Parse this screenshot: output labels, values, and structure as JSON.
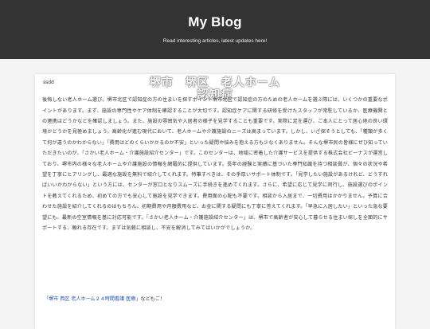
{
  "header": {
    "title": "My Blog",
    "tagline": "Read interesting articles, latest updates here!"
  },
  "post": {
    "heading_line1": "堺市　堺区　老人ホーム",
    "heading_line2": "認知症",
    "author": "ssdd",
    "body": "後悔しない老人ホーム選び。堺市北区で認知症の方の住まいを探すポイント堺市北区で認知症の方のための老人ホームを選ぶ際には、いくつかの重要なポイントがあります。まず、施設の専門性やケア体制を確認することが大切です。認知症ケアに関する研修を受けたスタッフが常駐しているか、医療機関との連携はどうかなどを確認しましょう。また、施設の雰囲気や入居者の様子を見学することも重要です。実際に足を運び、ご本人にとって居心地の良い環境かどうかを見極めましょう。高齢化が進む現代において、老人ホームや介護施設のニーズは高まっています。しかし、いざ探そうとしても、「種類が多くて何が違うのかわからない」「費用はどのくらいかかるのか不安」といった疑問や悩みを抱える方も少なくありません。そんな堺市民の皆様にぜひ知っていただきたいのが、「さかい老人ホーム・介護施設紹介センター」です。このセンターは、地域に密着した介護サービスを提供する株式会社ビーナスが運営しており、堺市内の様々な老人ホームや介護施設の情報を網羅的に提供しています。長年の経験と実績に基づいた専門知識を持つ相談員が、個々の状況や希望を丁寧にヒアリングし、最適な施設を無料で紹介してくれます。特筆すべきは、その手厚いサポート体制です。「見学したい施設があるけれど、どうすればいいかわからない」という方には、センターが窓口となりスムーズに手続きを進めてくれます。さらに、希望に応じて見学に同行し、施設選びのポイントを教えてくれるため、初めての方でも安心して施設を見学できます。費用面の心配も不要です。相談から入居まで、一切費用はかかりません。予算に合わせた施設を紹介してくれるのはもちろん、初期費用や月額費用など、お金に関する疑問にも丁寧に答えてくれます。「早急に入居したい」といった急な要望にも、最新の空室情報を基に対応可能です。「さかい老人ホーム・介護施設紹介センター」は、堺市で高齢者が安心して暮らせる住まい探しを全面的にサポートする、頼れる存在です。まずは気軽に相談し、不安を解消してみてはいかがでしょうか。",
    "link_text": "「堺市 西区 老人ホーム２４時間看護 医療」",
    "link_suffix": "などもご！"
  }
}
